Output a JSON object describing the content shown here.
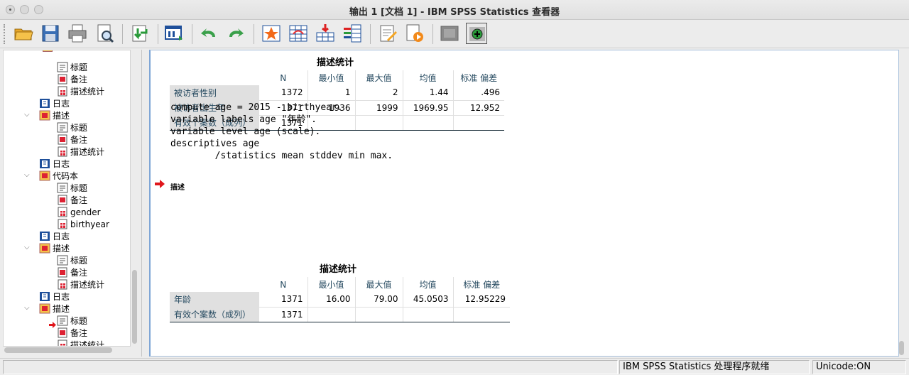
{
  "window": {
    "title": "输出 1 [文档 1] - IBM SPSS Statistics 查看器"
  },
  "toolbar": {
    "buttons": [
      "open",
      "save",
      "print",
      "print-preview",
      "export",
      "designate-window",
      "undo",
      "redo",
      "goto-case",
      "goto-variable",
      "insert-output",
      "variables",
      "insert-text",
      "insert-image",
      "hide",
      "show"
    ]
  },
  "tree": {
    "items": [
      {
        "label": "标题",
        "icon": "title-icon"
      },
      {
        "label": "备注",
        "icon": "notes-icon"
      },
      {
        "label": "描述统计",
        "icon": "table-icon"
      },
      {
        "label": "日志",
        "icon": "log-icon"
      },
      {
        "label": "描述",
        "icon": "folder-icon"
      },
      {
        "label": "标题",
        "icon": "title-icon"
      },
      {
        "label": "备注",
        "icon": "notes-icon"
      },
      {
        "label": "描述统计",
        "icon": "table-icon"
      },
      {
        "label": "日志",
        "icon": "log-icon"
      },
      {
        "label": "代码本",
        "icon": "folder-icon"
      },
      {
        "label": "标题",
        "icon": "title-icon"
      },
      {
        "label": "备注",
        "icon": "notes-icon"
      },
      {
        "label": "gender",
        "icon": "table-icon"
      },
      {
        "label": "birthyear",
        "icon": "table-icon"
      },
      {
        "label": "日志",
        "icon": "log-icon"
      },
      {
        "label": "描述",
        "icon": "folder-icon"
      },
      {
        "label": "标题",
        "icon": "title-icon"
      },
      {
        "label": "备注",
        "icon": "notes-icon"
      },
      {
        "label": "描述统计",
        "icon": "table-icon"
      },
      {
        "label": "日志",
        "icon": "log-icon"
      },
      {
        "label": "描述",
        "icon": "folder-icon"
      },
      {
        "label": "标题",
        "icon": "title-icon"
      },
      {
        "label": "备注",
        "icon": "notes-icon"
      },
      {
        "label": "描述统计",
        "icon": "table-icon"
      }
    ]
  },
  "table1": {
    "title": "描述统计",
    "headers": [
      "",
      "N",
      "最小值",
      "最大值",
      "均值",
      "标准 偏差"
    ],
    "rows": [
      [
        "被访者性别",
        "1372",
        "1",
        "2",
        "1.44",
        ".496"
      ],
      [
        "被访者出生年",
        "1371",
        "1936",
        "1999",
        "1969.95",
        "12.952"
      ],
      [
        "有效个案数（成列）",
        "1371",
        "",
        "",
        "",
        ""
      ]
    ]
  },
  "syntax": {
    "lines": [
      "compute age = 2015 - birthyear.",
      "variable labels age \"年龄\".",
      "variable level age (scale).",
      "descriptives age",
      "        /statistics mean stddev min max."
    ]
  },
  "section": {
    "label": "描述"
  },
  "table2": {
    "title": "描述统计",
    "headers": [
      "",
      "N",
      "最小值",
      "最大值",
      "均值",
      "标准 偏差"
    ],
    "rows": [
      [
        "年龄",
        "1371",
        "16.00",
        "79.00",
        "45.0503",
        "12.95229"
      ],
      [
        "有效个案数（成列）",
        "1371",
        "",
        "",
        "",
        ""
      ]
    ]
  },
  "status": {
    "processor": "IBM SPSS Statistics 处理程序就绪",
    "unicode": "Unicode:ON"
  }
}
